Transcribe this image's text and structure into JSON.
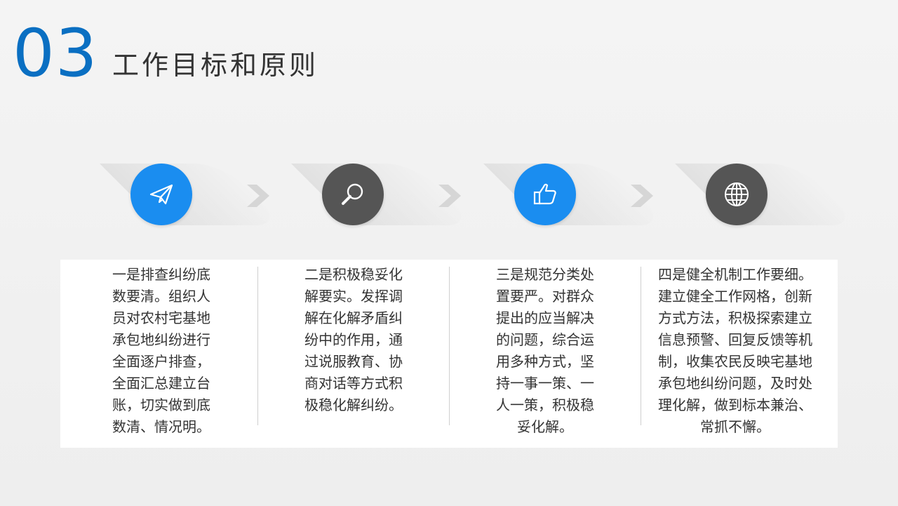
{
  "slide": {
    "section_number": "03",
    "title": "工作目标和原则"
  },
  "steps": [
    {
      "icon": "paper-plane-icon",
      "color": "#1a8df0"
    },
    {
      "icon": "magnifier-icon",
      "color": "#555555"
    },
    {
      "icon": "thumbs-up-icon",
      "color": "#1a8df0"
    },
    {
      "icon": "globe-icon",
      "color": "#555555"
    }
  ],
  "columns": [
    {
      "lines": [
        "一是排查纠纷底",
        "数要清。组织人",
        "员对农村宅基地",
        "承包地纠纷进行",
        "全面逐户排查，",
        "全面汇总建立台",
        "账，切实做到底",
        "数清、情况明。"
      ]
    },
    {
      "lines": [
        "二是积极稳妥化",
        "解要实。发挥调",
        "解在化解矛盾纠",
        "纷中的作用，通",
        "过说服教育、协",
        "商对话等方式积",
        "极稳化解纠纷。"
      ]
    },
    {
      "lines": [
        "三是规范分类处",
        "置要严。对群众",
        "提出的应当解决",
        "的问题，综合运",
        "用多种方式，坚",
        "持一事一策、一",
        "人一策，积极稳",
        "妥化解。"
      ]
    },
    {
      "lines": [
        "四是健全机制工作要细。",
        "建立健全工作网格，创新",
        "方式方法，积极探索建立",
        "信息预警、回复反馈等机",
        "制，收集农民反映宅基地",
        "承包地纠纷问题，及时处",
        "理化解，做到标本兼治、",
        "常抓不懈。"
      ]
    }
  ],
  "colors": {
    "accent_blue": "#0a6fc2",
    "icon_blue": "#1a8df0",
    "icon_gray": "#555555",
    "arrow_gray": "#d6d6d6"
  }
}
